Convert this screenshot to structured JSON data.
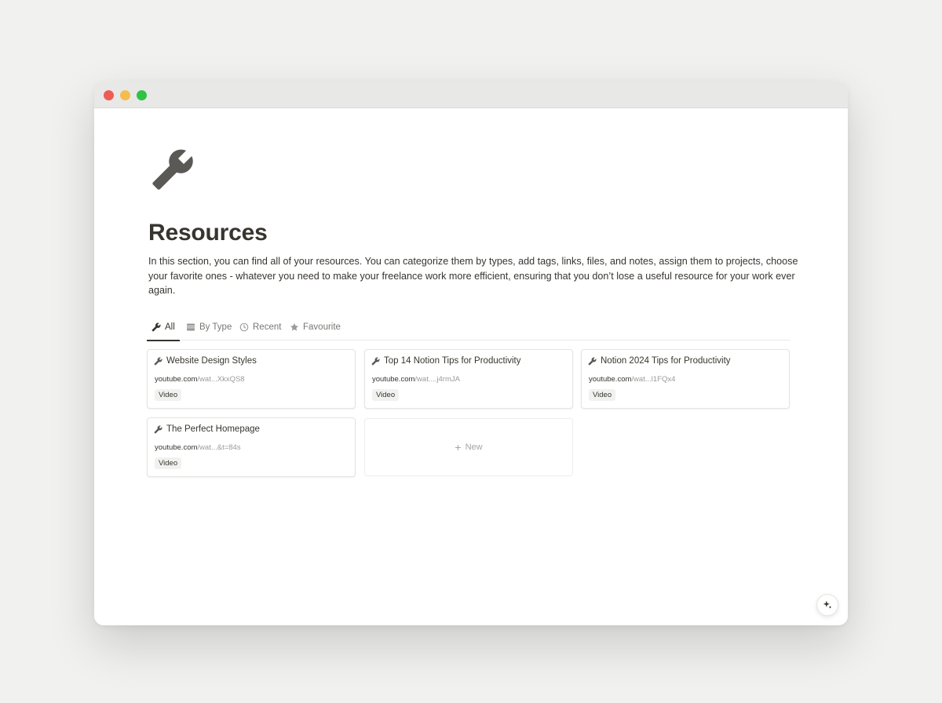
{
  "page": {
    "title": "Resources",
    "description": "In this section, you can find all of your resources. You can categorize them by types, add tags, links, files, and notes, assign them to projects, choose your favorite ones - whatever you need to make your freelance work more efficient, ensuring that you don’t lose a useful resource for your work ever again.",
    "icon": "wrench-icon"
  },
  "tabs": [
    {
      "label": "All",
      "icon": "wrench-icon",
      "active": true
    },
    {
      "label": "By Type",
      "icon": "table-icon",
      "active": false
    },
    {
      "label": "Recent",
      "icon": "clock-icon",
      "active": false
    },
    {
      "label": "Favourite",
      "icon": "star-icon",
      "active": false
    }
  ],
  "cards": [
    {
      "title": "Website Design Styles",
      "link_domain": "youtube.com",
      "link_rest": "/wat...XkxQS8",
      "tag": "Video"
    },
    {
      "title": "Top 14 Notion Tips for Productivity",
      "link_domain": "youtube.com",
      "link_rest": "/wat....j4rmJA",
      "tag": "Video"
    },
    {
      "title": "Notion 2024 Tips for Productivity",
      "link_domain": "youtube.com",
      "link_rest": "/wat...l1FQx4",
      "tag": "Video"
    },
    {
      "title": "The Perfect Homepage",
      "link_domain": "youtube.com",
      "link_rest": "/wat...&t=84s",
      "tag": "Video"
    }
  ],
  "new_card": {
    "label": "New"
  },
  "colors": {
    "text": "#37352f",
    "muted": "#787774",
    "window_bg": "#ffffff",
    "page_bg": "#f1f1ef"
  }
}
